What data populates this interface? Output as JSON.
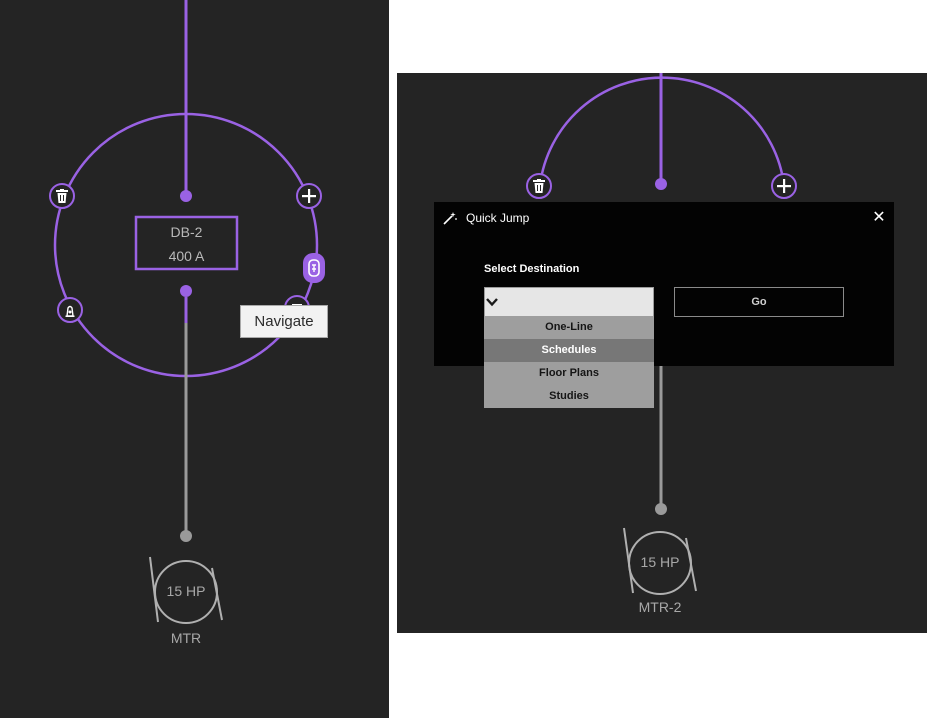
{
  "left_view": {
    "node": {
      "name": "DB-2",
      "rating": "400 A"
    },
    "motor": {
      "rating": "15 HP",
      "name": "MTR"
    },
    "tooltip": "Navigate",
    "icons": [
      "trash-icon",
      "plus-icon",
      "navigate-icon",
      "fire-extinguisher-icon",
      "schedule-icon"
    ]
  },
  "right_view": {
    "motor": {
      "rating": "15 HP",
      "name": "MTR-2"
    },
    "node": {
      "name": "DB-2",
      "rating": "400 A"
    }
  },
  "quick_jump": {
    "title": "Quick Jump",
    "close": "✕",
    "select_label": "Select Destination",
    "selected_value": "",
    "go_label": "Go",
    "options": [
      "One-Line",
      "Schedules",
      "Floor Plans",
      "Studies"
    ],
    "hovered_option": "Schedules"
  },
  "colors": {
    "accent": "#9a62e4",
    "background": "#242424",
    "muted": "#b0b0b0"
  }
}
